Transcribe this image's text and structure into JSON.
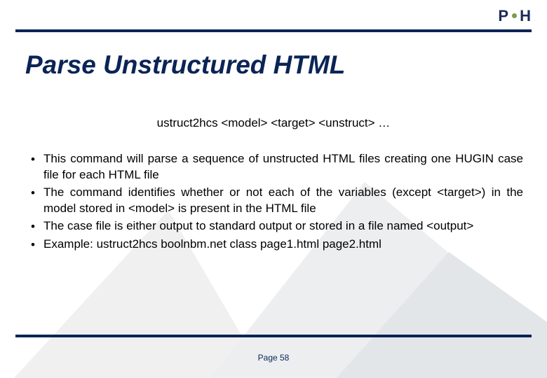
{
  "logo": {
    "p1": "P",
    "p2": "H"
  },
  "title": "Parse Unstructured HTML",
  "command": "ustruct2hcs <model> <target> <unstruct> …",
  "bullets": [
    "This command will parse a sequence of unstructed HTML files creating one HUGIN case file for each HTML file",
    "The command identifies whether or not each of the variables (except <target>) in the model stored in <model> is present in the HTML file",
    "The case file is either output to standard output or stored in a file named <output>",
    "Example: ustruct2hcs boolnbm.net class page1.html page2.html"
  ],
  "footer": "Page 58"
}
